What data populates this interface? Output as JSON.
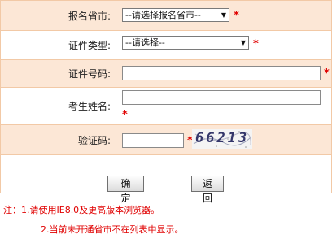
{
  "form": {
    "province": {
      "label": "报名省市:",
      "selected": "--请选择报名省市--",
      "required_mark": "*"
    },
    "id_type": {
      "label": "证件类型:",
      "selected": "--请选择--",
      "required_mark": "*"
    },
    "id_number": {
      "label": "证件号码:",
      "value": "",
      "required_mark": "*"
    },
    "name": {
      "label": "考生姓名:",
      "value": "",
      "required_mark": "*"
    },
    "captcha": {
      "label": "验证码:",
      "value": "",
      "required_mark": "*",
      "image_text": "66213"
    }
  },
  "buttons": {
    "confirm_label": "确 定",
    "back_label": "返 回"
  },
  "notes": {
    "line1": "注：1.请使用IE8.0及更高版本浏览器。",
    "line2": "2.当前未开通省市不在列表中显示。"
  },
  "colors": {
    "row_peach": "#fce7d6",
    "border": "#f2c9a6",
    "required": "#e00000"
  }
}
